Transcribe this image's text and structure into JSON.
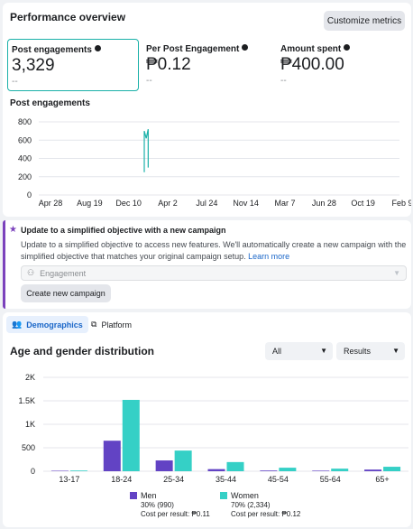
{
  "performance": {
    "title": "Performance overview",
    "customize_label": "Customize metrics",
    "metrics": [
      {
        "label": "Post engagements",
        "value": "3,329",
        "delta": "--"
      },
      {
        "label": "Per Post Engagement",
        "value": "₱0.12",
        "delta": "--"
      },
      {
        "label": "Amount spent",
        "value": "₱400.00",
        "delta": "--"
      }
    ],
    "chart_title": "Post engagements"
  },
  "notice": {
    "title": "Update to a simplified objective with a new campaign",
    "body": "Update to a simplified objective to access new features. We'll automatically create a new campaign with the simplified objective that matches your original campaign setup.",
    "link": "Learn more",
    "select_value": "Engagement",
    "create_label": "Create new campaign"
  },
  "demographics": {
    "tabs": [
      "Demographics",
      "Platform"
    ],
    "title": "Age and gender distribution",
    "filter_all": "All",
    "filter_results": "Results",
    "legend": [
      {
        "name": "Men",
        "share": "30% (990)",
        "cost": "Cost per result: ₱0.11",
        "color": "#6243c4"
      },
      {
        "name": "Women",
        "share": "70% (2,334)",
        "cost": "Cost per result: ₱0.12",
        "color": "#35d0c6"
      }
    ]
  },
  "chart_data": [
    {
      "type": "line",
      "title": "Post engagements",
      "x_ticks": [
        "Apr 28",
        "Aug 19",
        "Dec 10",
        "Apr 2",
        "Jul 24",
        "Nov 14",
        "Mar 7",
        "Jun 28",
        "Oct 19",
        "Feb 9"
      ],
      "y_ticks": [
        "800",
        "600",
        "400",
        "200",
        "0"
      ],
      "ylim": [
        0,
        800
      ],
      "series": [
        {
          "color": "#1bb1a9",
          "points": [
            [
              2.4,
              250
            ],
            [
              2.4,
              700
            ],
            [
              2.45,
              620
            ],
            [
              2.5,
              720
            ],
            [
              2.5,
              300
            ]
          ]
        }
      ]
    },
    {
      "type": "bar",
      "categories": [
        "13-17",
        "18-24",
        "25-34",
        "35-44",
        "45-54",
        "55-64",
        "65+"
      ],
      "y_ticks": [
        "2K",
        "1.5K",
        "1K",
        "500",
        "0"
      ],
      "ylim": [
        0,
        2000
      ],
      "series": [
        {
          "name": "Men",
          "color": "#6243c4",
          "values": [
            10,
            650,
            230,
            45,
            15,
            12,
            35
          ]
        },
        {
          "name": "Women",
          "color": "#35d0c6",
          "values": [
            15,
            1520,
            440,
            195,
            75,
            55,
            95
          ]
        }
      ]
    }
  ]
}
